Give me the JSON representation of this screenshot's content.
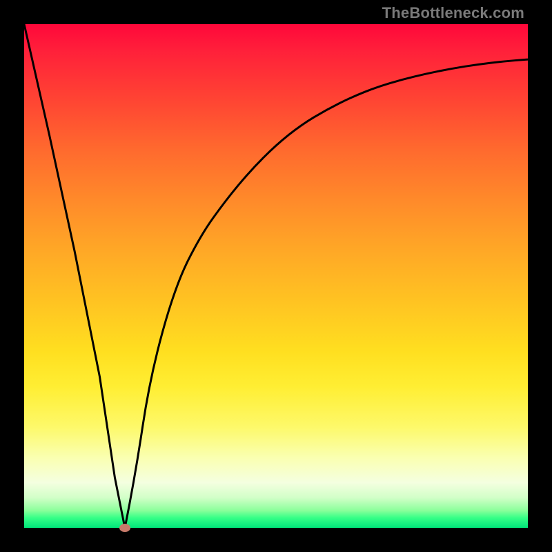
{
  "watermark": "TheBottleneck.com",
  "chart_data": {
    "type": "line",
    "title": "",
    "xlabel": "",
    "ylabel": "",
    "xlim": [
      0,
      100
    ],
    "ylim": [
      0,
      100
    ],
    "x": [
      0,
      5,
      10,
      15,
      18,
      20,
      22,
      25,
      30,
      35,
      40,
      45,
      50,
      55,
      60,
      65,
      70,
      75,
      80,
      85,
      90,
      95,
      100
    ],
    "values": [
      100,
      78,
      55,
      30,
      10,
      0,
      10,
      30,
      48,
      58,
      65,
      71,
      76,
      80,
      83,
      85.5,
      87.5,
      89,
      90.2,
      91.2,
      92,
      92.6,
      93
    ],
    "marker": {
      "x": 20,
      "y": 0
    },
    "series": [
      {
        "name": "curve",
        "x": [
          0,
          5,
          10,
          15,
          18,
          20,
          22,
          25,
          30,
          35,
          40,
          45,
          50,
          55,
          60,
          65,
          70,
          75,
          80,
          85,
          90,
          95,
          100
        ],
        "values": [
          100,
          78,
          55,
          30,
          10,
          0,
          10,
          30,
          48,
          58,
          65,
          71,
          76,
          80,
          83,
          85.5,
          87.5,
          89,
          90.2,
          91.2,
          92,
          92.6,
          93
        ]
      }
    ]
  }
}
